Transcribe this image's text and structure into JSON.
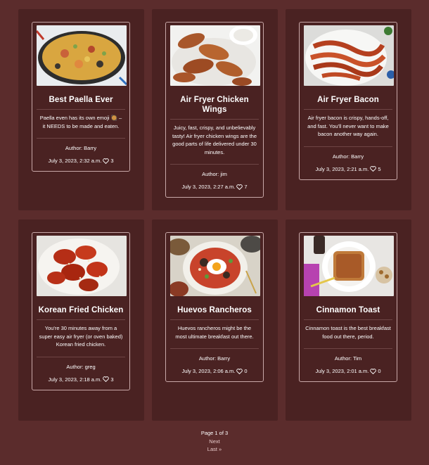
{
  "recipes": [
    {
      "title": "Best Paella Ever",
      "desc": "Paella even has its own emoji 🥘 – it NEEDS to be made and eaten.",
      "author": "Author: Barry",
      "date": "July 3, 2023, 2:32 a.m.",
      "likes": "3",
      "thumb": "paella"
    },
    {
      "title": "Air Fryer Chicken Wings",
      "desc": "Juicy, fast, crispy, and unbelievably tasty! Air fryer chicken wings are the good parts of life delivered under 30 minutes.",
      "author": "Author: jim",
      "date": "July 3, 2023, 2:27 a.m.",
      "likes": "7",
      "thumb": "wings"
    },
    {
      "title": "Air Fryer Bacon",
      "desc": "Air fryer bacon is crispy, hands-off, and fast. You'll never want to make bacon another way again.",
      "author": "Author: Barry",
      "date": "July 3, 2023, 2:21 a.m.",
      "likes": "5",
      "thumb": "bacon"
    },
    {
      "title": "Korean Fried Chicken",
      "desc": "You're 30 minutes away from a super easy air fryer (or oven baked) Korean fried chicken.",
      "author": "Author: greg",
      "date": "July 3, 2023, 2:18 a.m.",
      "likes": "3",
      "thumb": "korean"
    },
    {
      "title": "Huevos Rancheros",
      "desc": "Huevos rancheros might be the most ultimate breakfast out there.",
      "author": "Author: Barry",
      "date": "July 3, 2023, 2:06 a.m.",
      "likes": "0",
      "thumb": "huevos"
    },
    {
      "title": "Cinnamon Toast",
      "desc": "Cinnamon toast is the best breakfast food out there, period.",
      "author": "Author: Tim",
      "date": "July 3, 2023, 2:01 a.m.",
      "likes": "0",
      "thumb": "toast"
    }
  ],
  "pagination": {
    "info": "Page 1 of 3",
    "next": "Next",
    "last": "Last »"
  },
  "icons": {
    "like": "heart-icon"
  },
  "colors": {
    "page_bg": "#5b2c2c",
    "panel_bg": "#4a2222",
    "card_border": "#c8a8a8"
  }
}
